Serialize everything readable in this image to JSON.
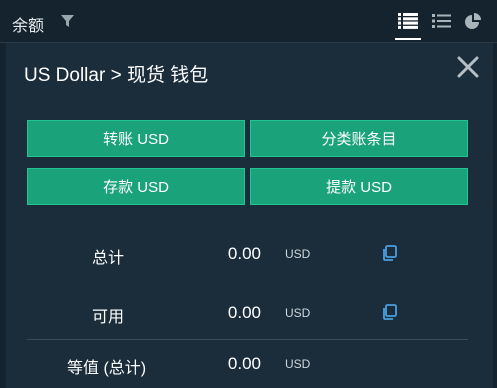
{
  "header": {
    "title": "余额",
    "icons": [
      "filter-icon",
      "list-dense-icon",
      "list-icon",
      "pie-chart-icon"
    ]
  },
  "panel": {
    "title": "US Dollar > 现货 钱包",
    "buttons": {
      "transfer": "转账 USD",
      "ledger": "分类账条目",
      "deposit": "存款 USD",
      "withdraw": "提款 USD"
    },
    "rows": [
      {
        "label": "总计",
        "value": "0.00",
        "unit": "USD",
        "icon": "copy-icon"
      },
      {
        "label": "可用",
        "value": "0.00",
        "unit": "USD",
        "icon": "copy-icon"
      },
      {
        "label": "等值 (总计)",
        "value": "0.00",
        "unit": "USD"
      }
    ]
  },
  "colors": {
    "background": "#14232e",
    "panel": "#1b2d3a",
    "button": "#1aa37a",
    "icon_accent": "#4a9fe0"
  }
}
